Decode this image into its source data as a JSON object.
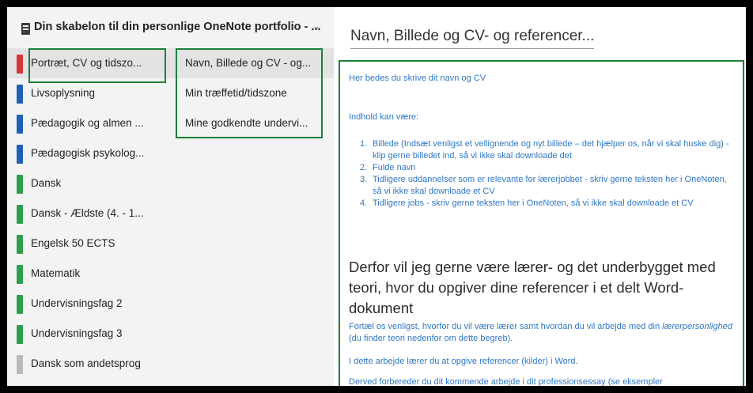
{
  "notebook": {
    "title": "Din skabelon til din personlige OneNote portfolio - ...",
    "chevron": "⌄"
  },
  "sections": [
    {
      "label": "Portræt, CV og tidszo...",
      "color": "#d63737"
    },
    {
      "label": "Livsoplysning",
      "color": "#1f5fb5"
    },
    {
      "label": "Pædagogik og almen ...",
      "color": "#1f5fb5"
    },
    {
      "label": "Pædagogisk psykolog...",
      "color": "#1f5fb5"
    },
    {
      "label": "Dansk",
      "color": "#2e9e4e"
    },
    {
      "label": "Dansk - Ældste (4. - 1...",
      "color": "#2e9e4e"
    },
    {
      "label": "Engelsk 50 ECTS",
      "color": "#2e9e4e"
    },
    {
      "label": "Matematik",
      "color": "#2e9e4e"
    },
    {
      "label": "Undervisningsfag 2",
      "color": "#2e9e4e"
    },
    {
      "label": "Undervisningsfag 3",
      "color": "#2e9e4e"
    },
    {
      "label": "Dansk som andetsprog",
      "color": "#b9b9b9"
    }
  ],
  "pages": [
    {
      "label": "Navn, Billede og CV - og..."
    },
    {
      "label": "Min træffetid/tidszone"
    },
    {
      "label": "Mine godkendte undervi..."
    }
  ],
  "page_title": "Navn, Billede og CV- og referencer...",
  "content": {
    "intro": "Her bedes du skrive dit navn og CV",
    "indhold": "Indhold kan være:",
    "list": [
      {
        "num": "1.",
        "text": "Billede (Indsæt venligst et vellignende og nyt billede – det hjælper os, når vi skal huske dig) - klip gerne billedet ind, så vi ikke skal downloade det"
      },
      {
        "num": "2.",
        "text": "Fulde navn"
      },
      {
        "num": "3.",
        "text": "Tidligere uddannelser som er relevante for lærerjobbet - skriv gerne teksten her i OneNoten, så vi ikke skal downloade et CV"
      },
      {
        "num": "4.",
        "text": "Tidligere jobs - skriv gerne teksten her i OneNoten, så vi ikke skal downloade et CV"
      }
    ],
    "heading": "Derfor vil jeg gerne være lærer- og det underbygget med teori, hvor du opgiver dine referencer i et delt Word-dokument",
    "para1_a": "Fortæl os venligst, hvorfor du vil være lærer samt hvordan du vil arbejde med din ",
    "para1_em": "lærerpersonlighed",
    "para1_b": " (du finder teori nedenfor om dette begreb).",
    "para2": "I dette arbejde lærer du at opgive referencer (kilder) i Word.",
    "para3": "Derved forbereder du dit kommende arbejde i dit professionsessay (se eksempler"
  }
}
